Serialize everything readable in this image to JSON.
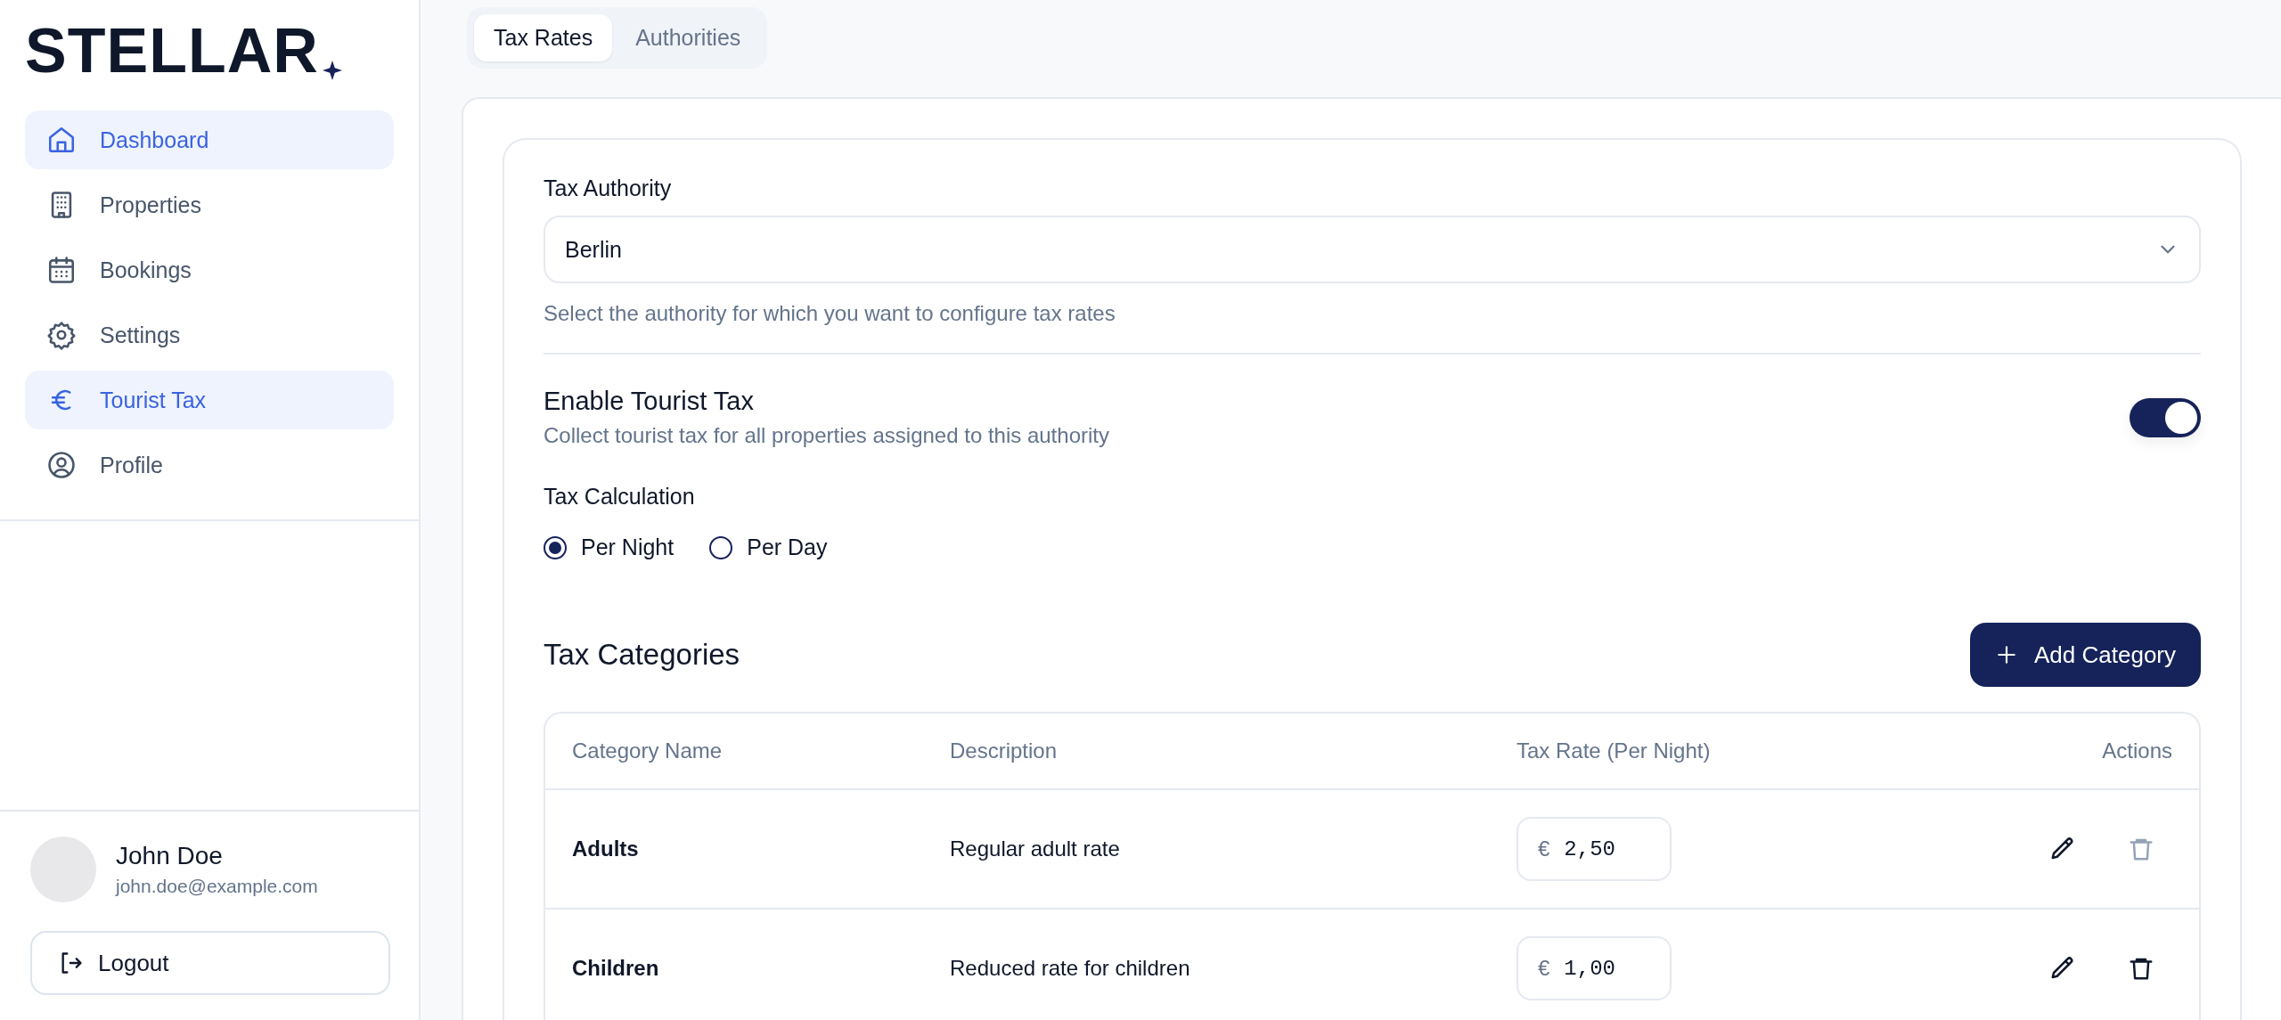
{
  "sidebar": {
    "logo": "STELLAR",
    "items": [
      {
        "label": "Dashboard",
        "kind": "home",
        "selected": true
      },
      {
        "label": "Properties",
        "kind": "building",
        "selected": false
      },
      {
        "label": "Bookings",
        "kind": "calendar",
        "selected": false
      },
      {
        "label": "Settings",
        "kind": "gear",
        "selected": false
      },
      {
        "label": "Tourist Tax",
        "kind": "euro",
        "selected": true
      },
      {
        "label": "Profile",
        "kind": "user",
        "selected": false
      }
    ],
    "user": {
      "name": "John Doe",
      "email": "john.doe@example.com"
    },
    "logout": "Logout"
  },
  "tabs": [
    {
      "label": "Tax Rates",
      "selected": true
    },
    {
      "label": "Authorities",
      "selected": false
    }
  ],
  "authority": {
    "label": "Tax Authority",
    "value": "Berlin",
    "hint": "Select the authority for which you want to configure tax rates"
  },
  "enable": {
    "title": "Enable Tourist Tax",
    "description": "Collect tourist tax for all properties assigned to this authority",
    "on": true
  },
  "calculation": {
    "label": "Tax Calculation",
    "options": [
      {
        "label": "Per Night",
        "selected": true
      },
      {
        "label": "Per Day",
        "selected": false
      }
    ]
  },
  "categories": {
    "title": "Tax Categories",
    "add_button": "Add Category",
    "columns": [
      "Category Name",
      "Description",
      "Tax Rate (Per Night)",
      "Actions"
    ],
    "rows": [
      {
        "name": "Adults",
        "description": "Regular adult rate",
        "currency": "€",
        "rate": "2,50",
        "delete_disabled": true
      },
      {
        "name": "Children",
        "description": "Reduced rate for children",
        "currency": "€",
        "rate": "1,00",
        "delete_disabled": false
      }
    ]
  }
}
